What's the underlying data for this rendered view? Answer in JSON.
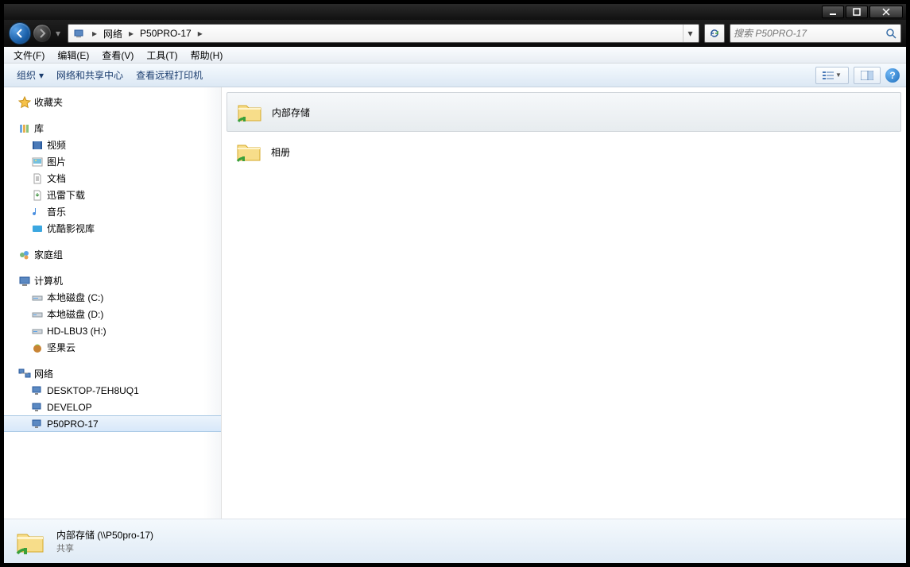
{
  "breadcrumbs": [
    {
      "label": "网络"
    },
    {
      "label": "P50PRO-17"
    }
  ],
  "search": {
    "placeholder": "搜索 P50PRO-17"
  },
  "menu": {
    "file": "文件(F)",
    "edit": "编辑(E)",
    "view": "查看(V)",
    "tools": "工具(T)",
    "help": "帮助(H)"
  },
  "toolbar": {
    "organize": "组织",
    "netcenter": "网络和共享中心",
    "remoteprint": "查看远程打印机"
  },
  "sidebar": {
    "favorites": "收藏夹",
    "libraries": "库",
    "lib_items": [
      "视频",
      "图片",
      "文档",
      "迅雷下载",
      "音乐",
      "优酷影视库"
    ],
    "homegroup": "家庭组",
    "computer": "计算机",
    "drives": [
      "本地磁盘 (C:)",
      "本地磁盘 (D:)",
      "HD-LBU3 (H:)",
      "坚果云"
    ],
    "network": "网络",
    "hosts": [
      "DESKTOP-7EH8UQ1",
      "DEVELOP",
      "P50PRO-17"
    ]
  },
  "content": {
    "items": [
      {
        "label": "内部存储",
        "selected": true
      },
      {
        "label": "相册",
        "selected": false
      }
    ]
  },
  "details": {
    "title": "内部存储 (\\\\P50pro-17)",
    "sub": "共享"
  }
}
